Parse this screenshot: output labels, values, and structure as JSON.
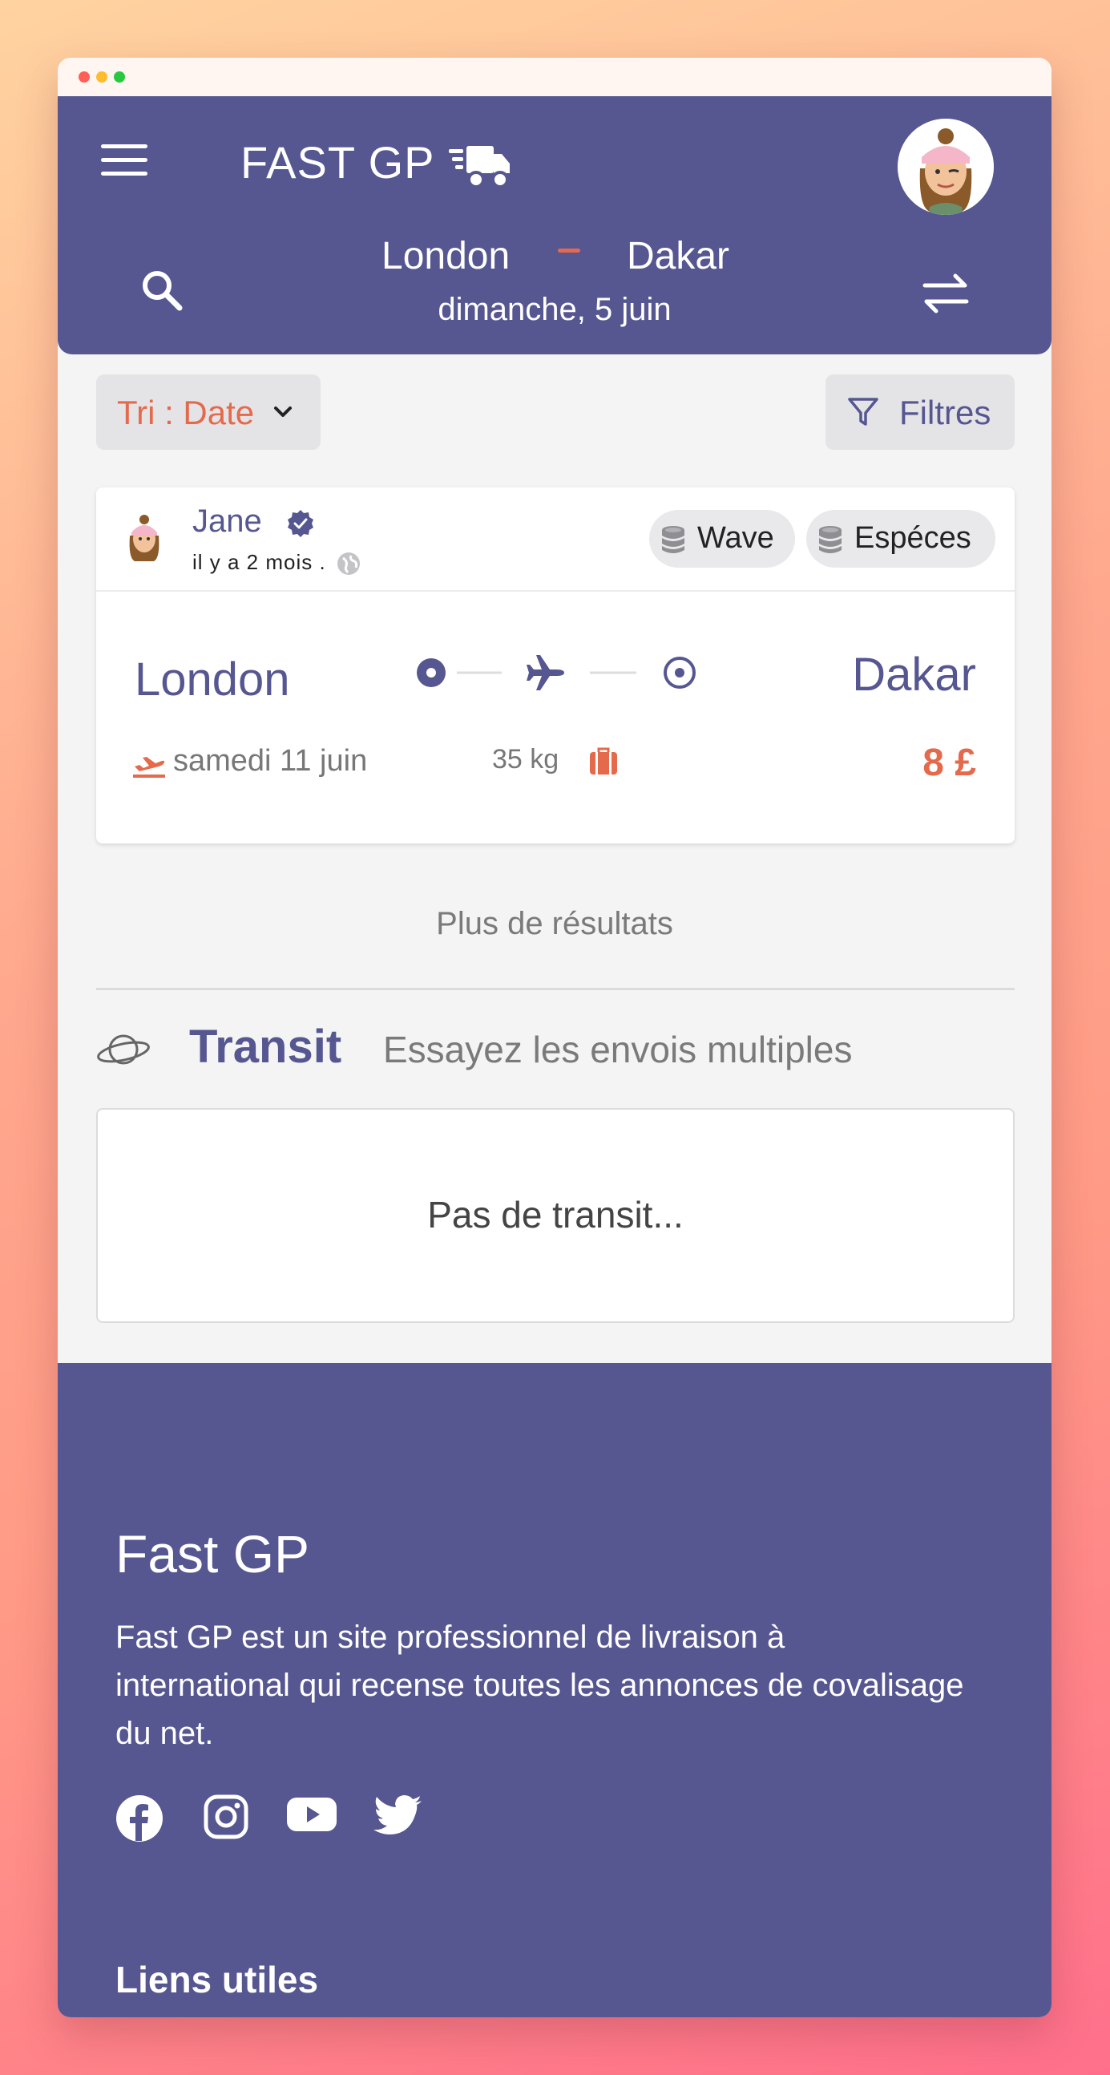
{
  "colors": {
    "primary": "#565691",
    "accent": "#e56a4c",
    "background": "#f4f4f5",
    "card": "#ffffff"
  },
  "header": {
    "brand": "FAST GP",
    "brand_icon": "truck-icon",
    "route": {
      "from": "London",
      "to": "Dakar",
      "date": "dimanche, 5 juin"
    },
    "icons": [
      "menu-icon",
      "search-icon",
      "swap-arrows-icon",
      "avatar"
    ]
  },
  "toolbar": {
    "sort_label": "Tri : Date",
    "filter_label": "Filtres"
  },
  "result_card": {
    "user": {
      "name": "Jane",
      "verified": true,
      "posted": "il y a 2 mois ."
    },
    "payment_methods": [
      "Wave",
      "Espéces"
    ],
    "from": "London",
    "to": "Dakar",
    "date": "samedi 11 juin",
    "weight": "35 kg",
    "price": "8 £"
  },
  "more_results": "Plus de résultats",
  "transit": {
    "title": "Transit",
    "subtitle": "Essayez les envois multiples",
    "empty_text": "Pas de transit..."
  },
  "footer": {
    "title": "Fast GP",
    "description": "Fast GP est un site professionnel de livraison à international qui recense toutes les annonces de covalisage du net.",
    "social": [
      "facebook-icon",
      "instagram-icon",
      "youtube-icon",
      "twitter-icon"
    ],
    "links_heading": "Liens utiles"
  }
}
